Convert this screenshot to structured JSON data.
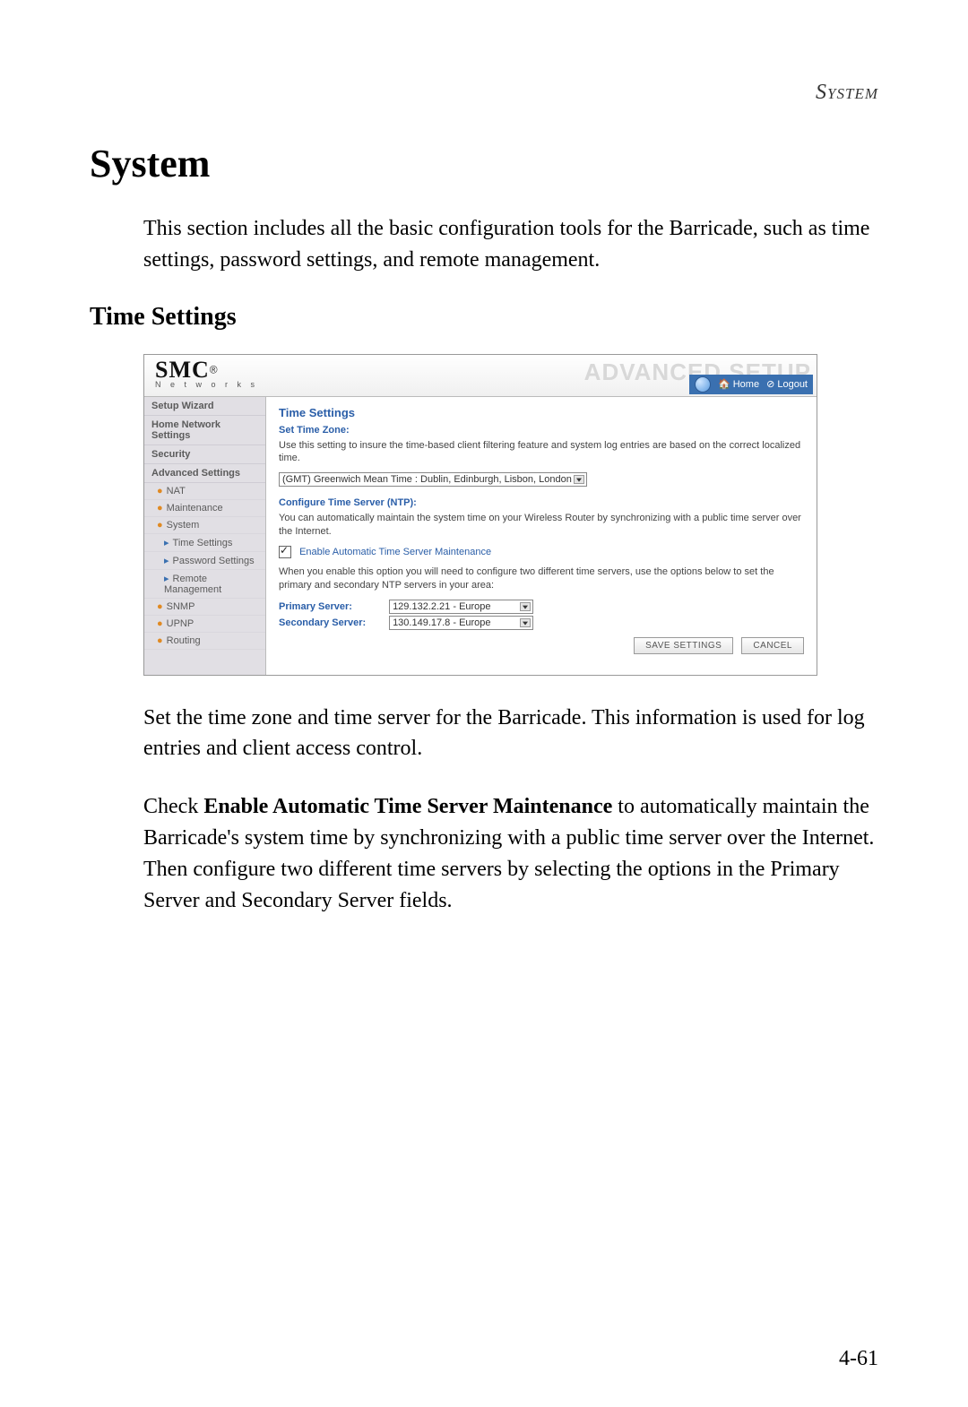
{
  "doc": {
    "running_head": "System",
    "h1": "System",
    "intro": "This section includes all the basic configuration tools for the Barricade, such as time settings, password settings, and remote management.",
    "h2": "Time Settings",
    "para1": "Set the time zone and time server for the Barricade. This information is used for log entries and client access control.",
    "para2_pre": "Check ",
    "para2_bold": "Enable Automatic Time Server Maintenance",
    "para2_post": " to automatically maintain the Barricade's system time by synchronizing with a public time server over the Internet. Then configure two different time servers by selecting the options in the Primary Server and Secondary Server fields.",
    "page_number": "4-61"
  },
  "app": {
    "logo_main": "SMC",
    "logo_reg": "®",
    "logo_sub": "N e t w o r k s",
    "banner": "ADVANCED SETUP",
    "topbar": {
      "home": "Home",
      "logout": "Logout"
    },
    "sidebar": {
      "groups": [
        "Setup Wizard",
        "Home Network Settings",
        "Security",
        "Advanced Settings"
      ],
      "adv_items": [
        "NAT",
        "Maintenance",
        "System"
      ],
      "system_sub": [
        "Time Settings",
        "Password Settings",
        "Remote Management"
      ],
      "adv_items_after": [
        "SNMP",
        "UPNP",
        "Routing"
      ]
    },
    "content": {
      "title": "Time Settings",
      "set_tz": "Set Time Zone:",
      "tz_help": "Use this setting to insure the time-based client filtering feature and system log entries are based on the correct localized time.",
      "tz_value": "(GMT) Greenwich Mean Time : Dublin, Edinburgh, Lisbon, London",
      "ntp_title": "Configure Time Server (NTP):",
      "ntp_help": "You can automatically maintain the system time on your Wireless Router by synchronizing with a public time server over the Internet.",
      "chk_label": "Enable Automatic Time Server Maintenance",
      "ntp_note": "When you enable this option you will need to configure two different time servers, use the options below to set the primary and secondary NTP servers in your area:",
      "primary_label": "Primary Server:",
      "primary_value": "129.132.2.21 - Europe",
      "secondary_label": "Secondary Server:",
      "secondary_value": "130.149.17.8 - Europe",
      "save_btn": "SAVE SETTINGS",
      "cancel_btn": "CANCEL"
    }
  }
}
